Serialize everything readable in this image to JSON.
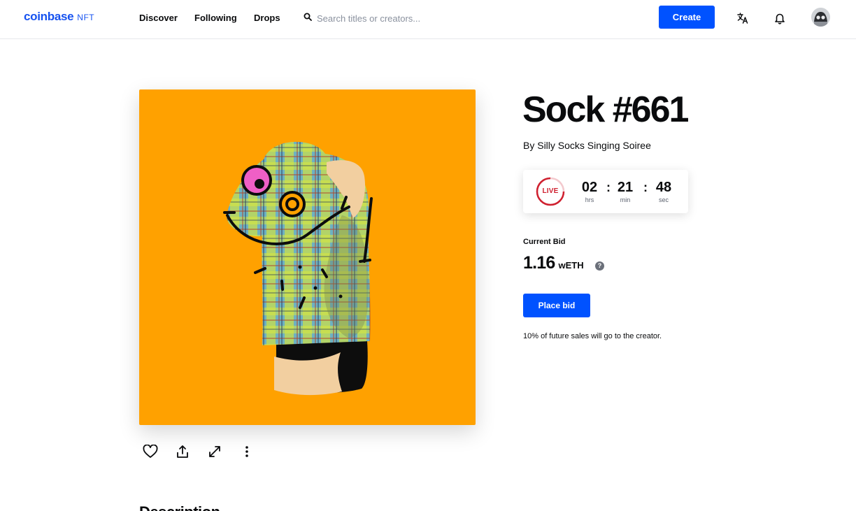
{
  "header": {
    "logo_word": "coinbase",
    "logo_suffix": "NFT",
    "nav": [
      "Discover",
      "Following",
      "Drops"
    ],
    "search_placeholder": "Search titles or creators...",
    "create_label": "Create",
    "icons": [
      "search-icon",
      "language-icon",
      "bell-icon",
      "avatar"
    ]
  },
  "artwork": {
    "background_color": "#ffa100",
    "actions": [
      "heart-icon",
      "share-icon",
      "expand-icon",
      "more-vertical-icon"
    ]
  },
  "detail": {
    "title": "Sock #661",
    "creator": "By Silly Socks Singing Soiree",
    "timer": {
      "live_label": "LIVE",
      "hours": "02",
      "hours_label": "hrs",
      "minutes": "21",
      "minutes_label": "min",
      "seconds": "48",
      "seconds_label": "sec"
    },
    "current_bid_label": "Current Bid",
    "bid_value": "1.16",
    "bid_unit": "wETH",
    "help_symbol": "?",
    "place_bid_label": "Place bid",
    "royalty_note": "10% of future sales will go to the creator."
  },
  "description_heading": "Description",
  "colors": {
    "brand_blue": "#0052ff",
    "logo_blue": "#1652f0",
    "live_red": "#cf202f"
  }
}
